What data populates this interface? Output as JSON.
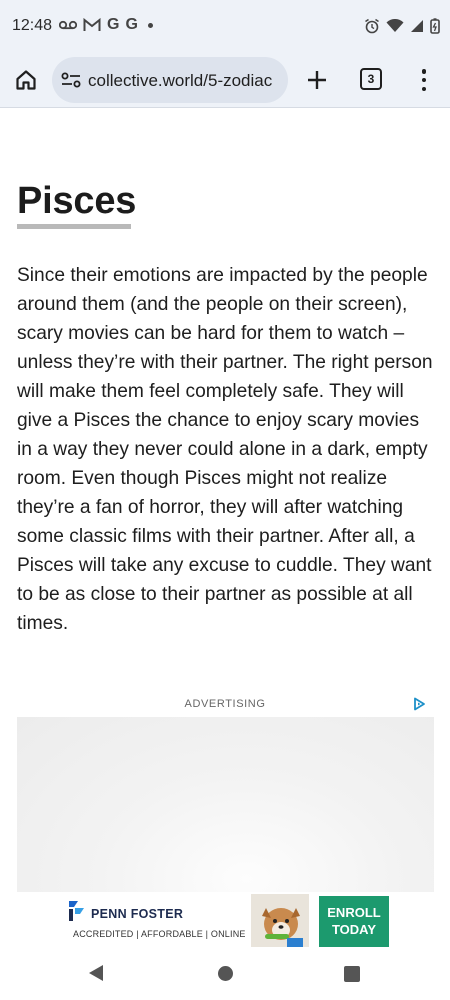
{
  "status_bar": {
    "time": "12:48",
    "left_icons": [
      "voicemail-icon",
      "gmail-icon",
      "google-icon",
      "google-icon",
      "notification-dot"
    ],
    "right_icons": [
      "alarm-icon",
      "wifi-icon",
      "signal-icon",
      "battery-icon"
    ],
    "g1": "G",
    "g2": "G"
  },
  "browser": {
    "url": "collective.world/5-zodiac",
    "tab_count": "3",
    "url_icon": "site-settings-icon"
  },
  "article": {
    "title": "Pisces",
    "body": "Since their emotions are impacted by the people around them (and the people on their screen), scary movies can be hard for them to watch – unless they’re with their partner. The right person will make them feel completely safe. They will give a Pisces the chance to enjoy scary movies in a way they never could alone in a dark, empty room. Even though Pisces might not realize they’re a fan of horror, they will after watching some classic films with their partner. After all, a Pisces will take any excuse to cuddle. They want to be as close to their partner as possible at all times."
  },
  "ad": {
    "label": "ADVERTISING"
  },
  "banner": {
    "brand": "PENN FOSTER",
    "tagline": "ACCREDITED | AFFORDABLE | ONLINE",
    "cta_line1": "ENROLL",
    "cta_line2": "TODAY",
    "cta_color": "#1c9a6e"
  },
  "nav": {
    "icons": [
      "back-icon",
      "home-icon",
      "recents-icon"
    ]
  }
}
